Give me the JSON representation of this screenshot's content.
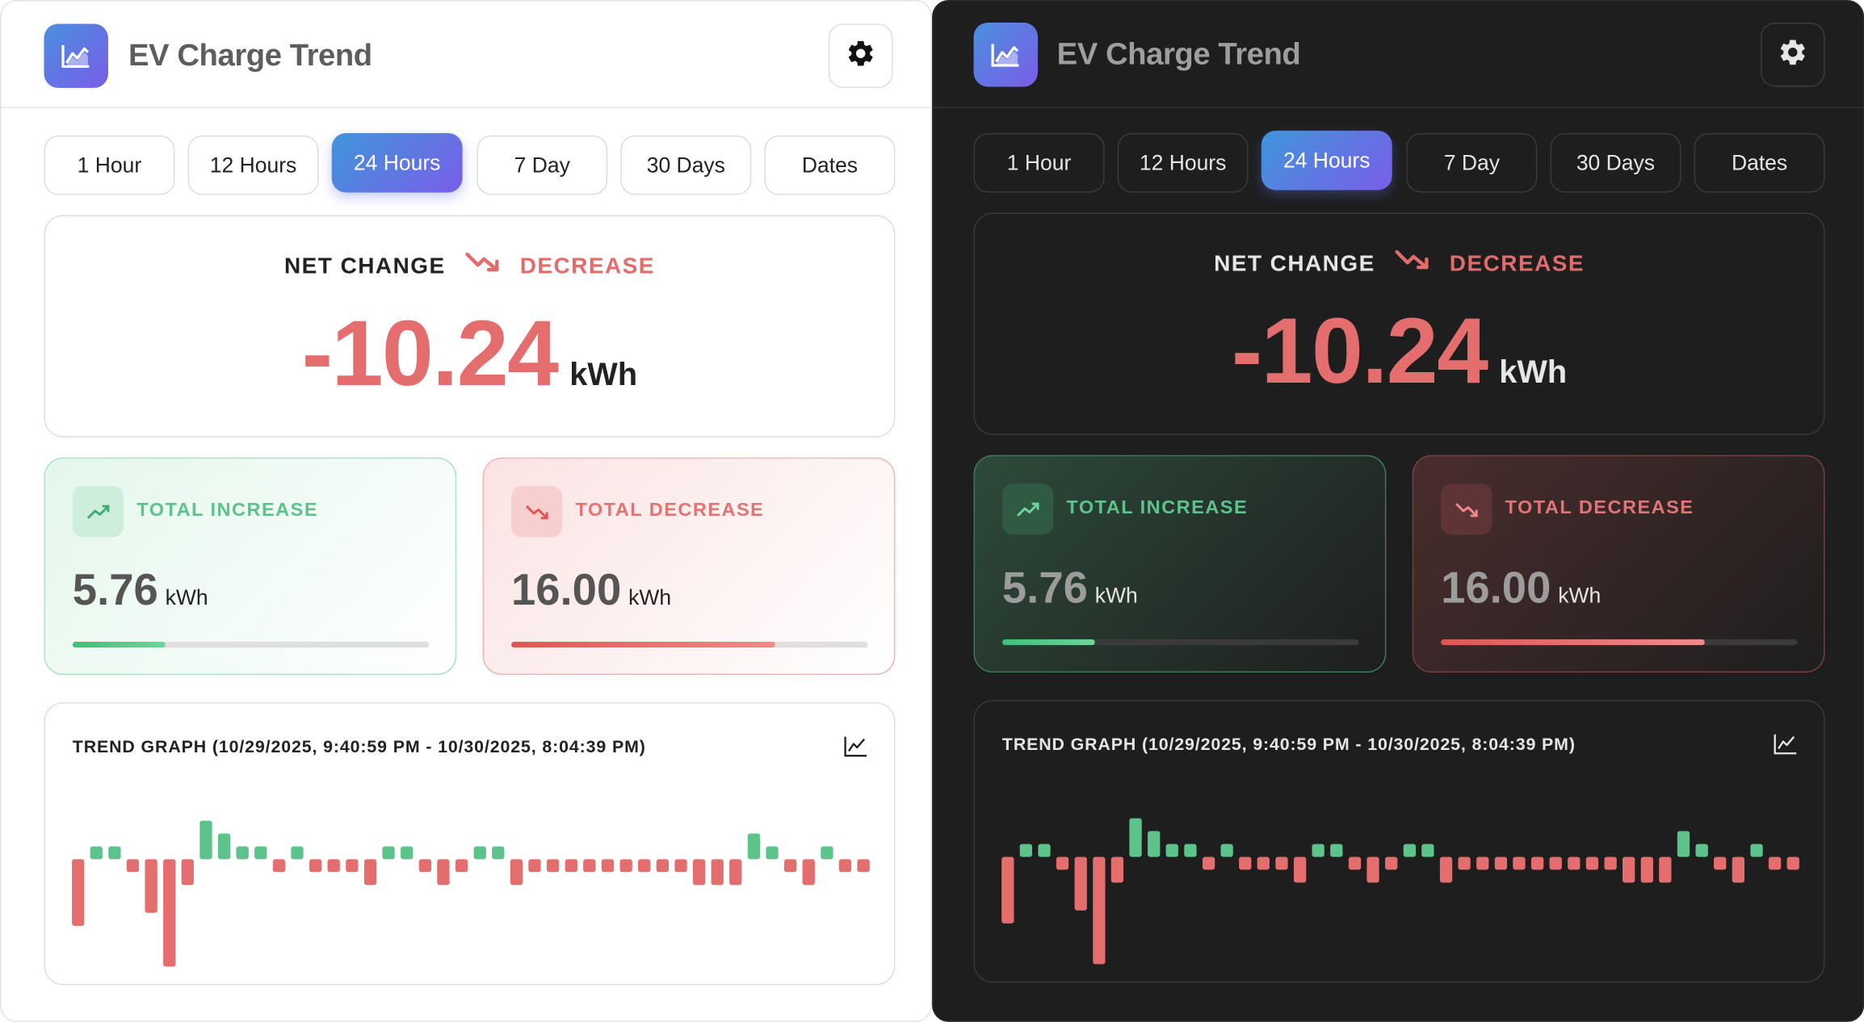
{
  "app": {
    "title": "EV Charge Trend"
  },
  "tabs": [
    "1 Hour",
    "12 Hours",
    "24 Hours",
    "7 Day",
    "30 Days",
    "Dates"
  ],
  "active_tab": "24 Hours",
  "net_change": {
    "label": "NET CHANGE",
    "direction": "DECREASE",
    "value": "-10.24",
    "unit": "kWh"
  },
  "total_increase": {
    "label": "TOTAL INCREASE",
    "value": "5.76",
    "unit": "kWh",
    "progress": 0.26
  },
  "total_decrease": {
    "label": "TOTAL DECREASE",
    "value": "16.00",
    "unit": "kWh",
    "progress": 0.74
  },
  "trend": {
    "title": "TREND GRAPH",
    "range": "(10/29/2025, 9:40:59 PM - 10/30/2025, 8:04:39 PM)"
  },
  "colors": {
    "increase": "#5cc48a",
    "decrease": "#e46d6d",
    "accent_start": "#3f96dc",
    "accent_end": "#7a5ee8"
  },
  "icons": {
    "app": "chart-line-icon",
    "settings": "gear-icon",
    "trend_up": "trending-up-icon",
    "trend_down": "trending-down-icon",
    "chart": "chart-line-icon"
  },
  "chart_data": {
    "type": "bar",
    "values": [
      -3.1,
      0.6,
      0.6,
      -0.6,
      -2.5,
      -5.0,
      -1.2,
      1.8,
      1.2,
      0.6,
      0.6,
      -0.6,
      0.6,
      -0.6,
      -0.6,
      -0.6,
      -1.2,
      0.6,
      0.6,
      -0.6,
      -1.2,
      -0.6,
      0.6,
      0.6,
      -1.2,
      -0.6,
      -0.6,
      -0.6,
      -0.6,
      -0.6,
      -0.6,
      -0.6,
      -0.6,
      -0.6,
      -1.2,
      -1.2,
      -1.2,
      1.2,
      0.6,
      -0.6,
      -1.2,
      0.6,
      -0.6,
      -0.6
    ],
    "ylim": [
      -5.2,
      2.0
    ]
  }
}
